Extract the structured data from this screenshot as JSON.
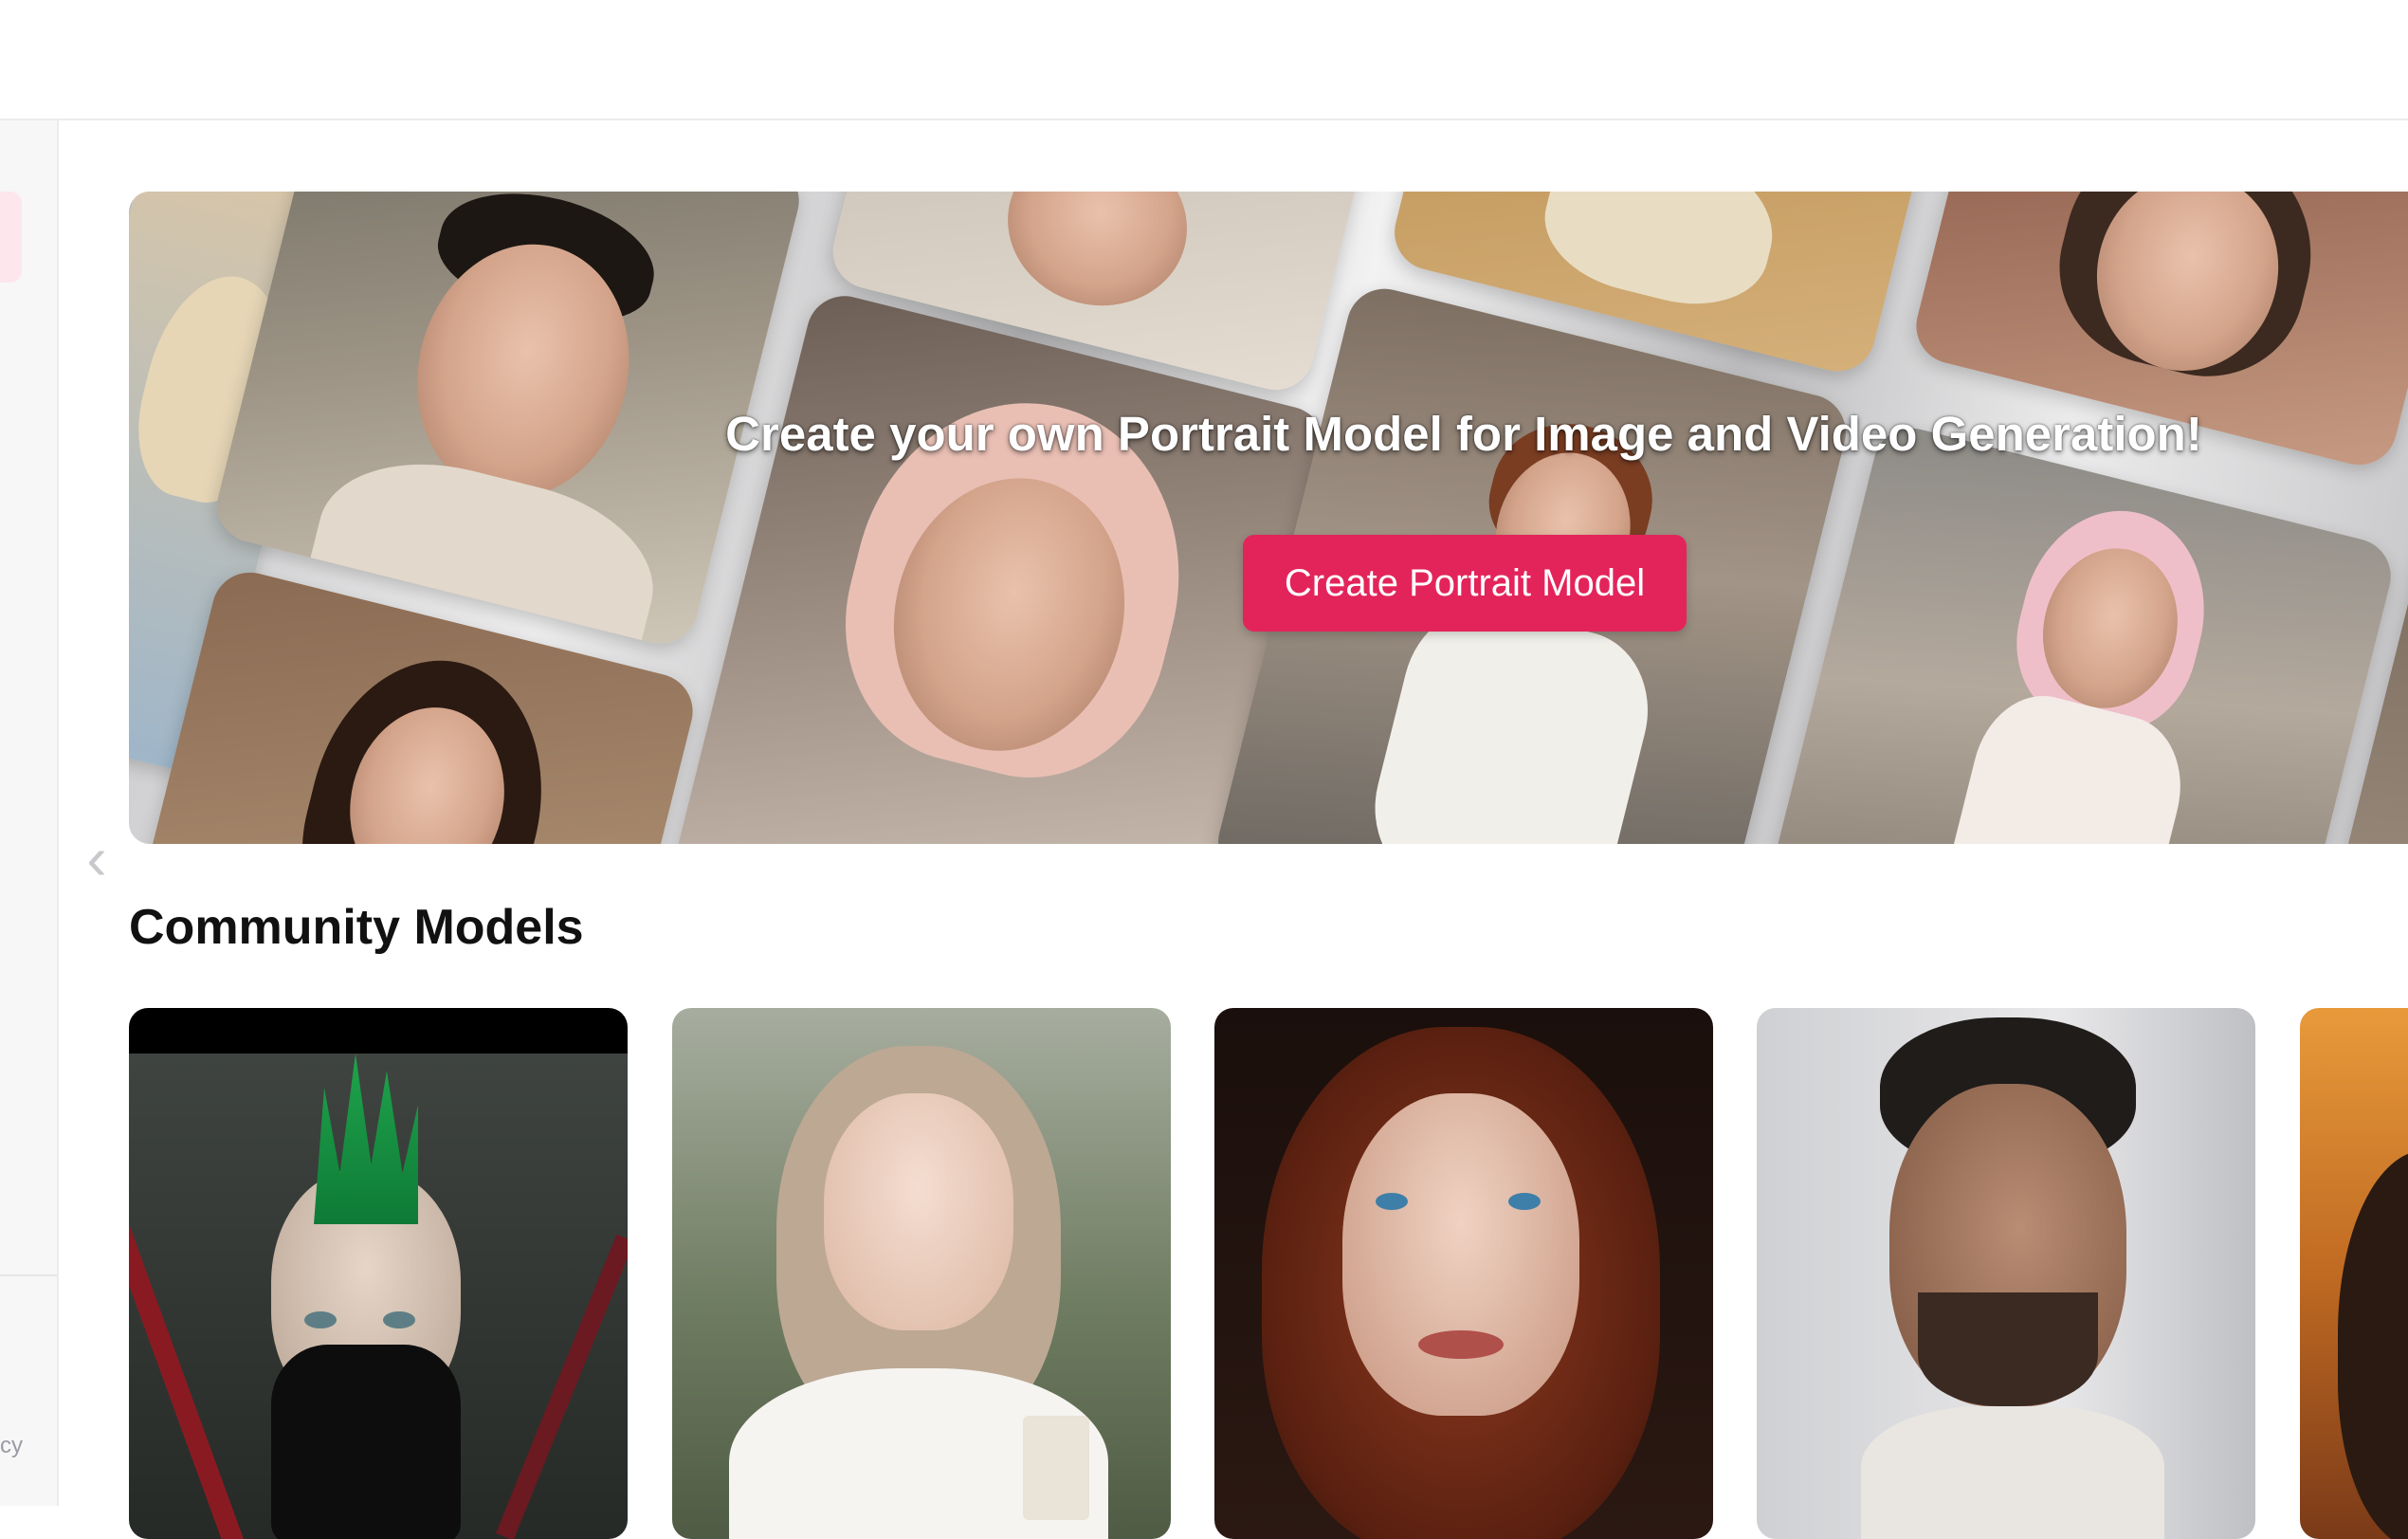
{
  "hero": {
    "title": "Create your own Portrait Model for Image and Video Generation!",
    "cta_label": "Create Portrait Model"
  },
  "community": {
    "title": "Community Models",
    "cards": [
      {
        "subject": "green-mohawk-warrior"
      },
      {
        "subject": "blonde-woman-coffee"
      },
      {
        "subject": "redhead-woman"
      },
      {
        "subject": "bearded-man"
      },
      {
        "subject": "woman-partial"
      }
    ]
  },
  "sidebar": {
    "footer_text": "cy"
  },
  "colors": {
    "accent": "#e3245a",
    "sidebar_bg": "#f7f7f8",
    "border": "#ececee"
  },
  "icons": {
    "carousel_prev": "chevron-left-icon"
  }
}
